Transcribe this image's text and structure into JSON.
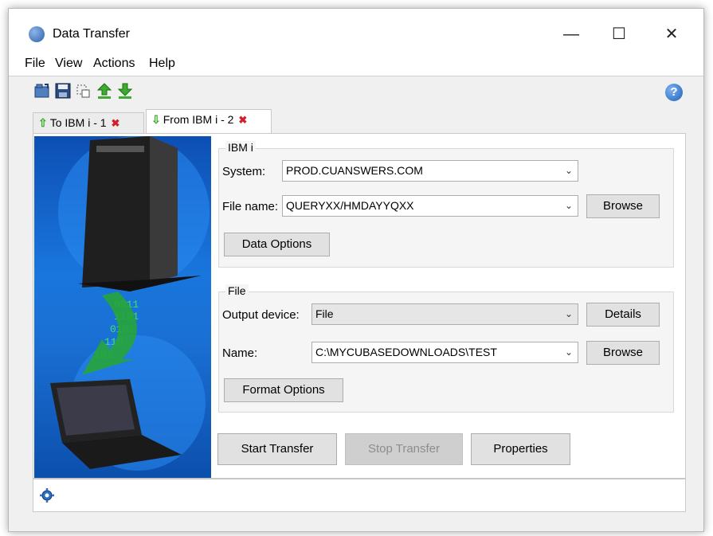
{
  "window": {
    "title": "Data Transfer",
    "minimize": "—",
    "maximize": "☐",
    "close": "✕"
  },
  "menu": {
    "items": [
      "File",
      "View",
      "Actions",
      "Help"
    ]
  },
  "toolbar": {
    "help": "?"
  },
  "tabs": [
    {
      "label": "To IBM i - 1",
      "active": false
    },
    {
      "label": "From IBM i - 2",
      "active": true
    }
  ],
  "art": {
    "binary": [
      "0011",
      "1101",
      "0101",
      "110",
      "101"
    ]
  },
  "ibm_group": {
    "title": "IBM i",
    "system_label": "System:",
    "system_value": "PROD.CUANSWERS.COM",
    "filename_label": "File name:",
    "filename_value": "QUERYXX/HMDAYYQXX",
    "browse": "Browse",
    "data_options": "Data Options"
  },
  "file_group": {
    "title": "File",
    "output_label": "Output device:",
    "output_value": "File",
    "details": "Details",
    "name_label": "Name:",
    "name_value": "C:\\MYCUBASEDOWNLOADS\\TEST",
    "browse": "Browse",
    "format_options": "Format Options"
  },
  "actions": {
    "start": "Start Transfer",
    "stop": "Stop Transfer",
    "properties": "Properties"
  },
  "colors": {
    "accent_green": "#3cab2f",
    "close_red": "#d0202a",
    "art_blue": "#1976dd"
  }
}
